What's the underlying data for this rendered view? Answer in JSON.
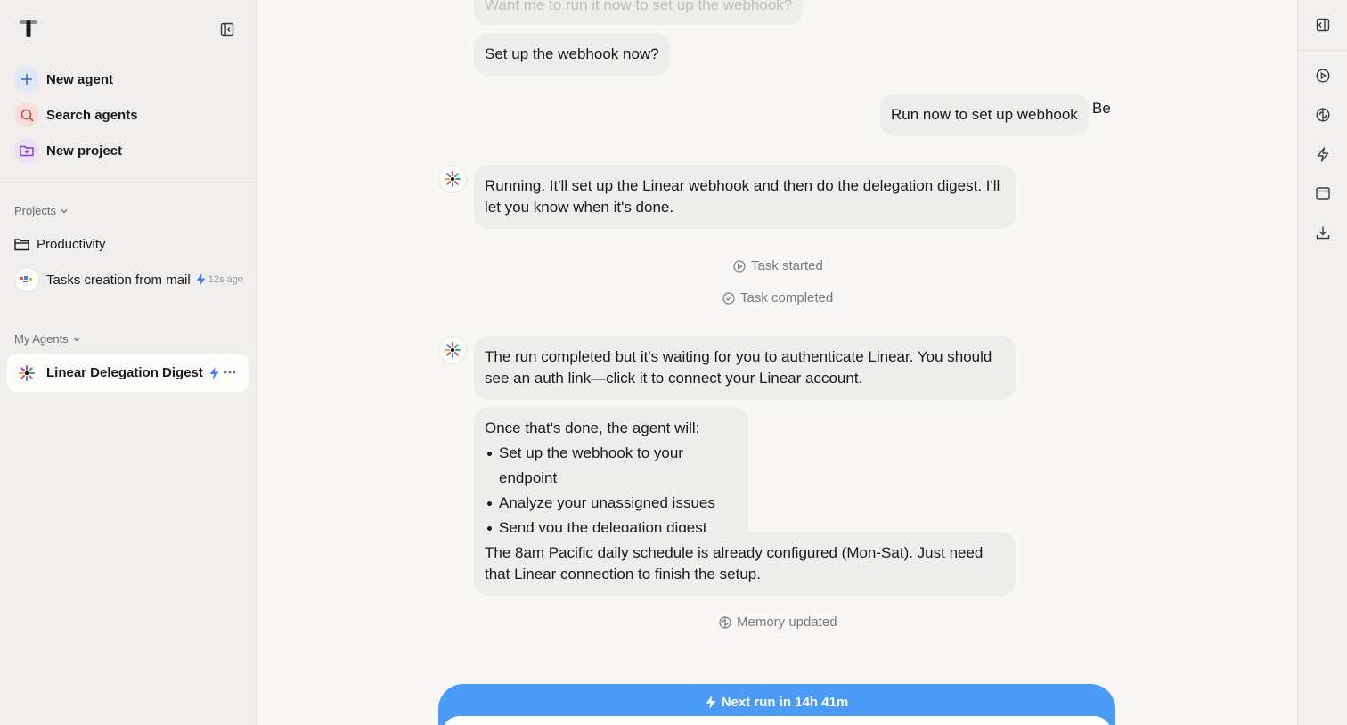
{
  "sidebar": {
    "nav": [
      {
        "label": "New agent",
        "icon": "plus-icon",
        "color": "#3b6fd8",
        "bg": "#dfe8f7"
      },
      {
        "label": "Search agents",
        "icon": "search-icon",
        "color": "#d2453d",
        "bg": "#f6dedb"
      },
      {
        "label": "New project",
        "icon": "folder-plus-icon",
        "color": "#8a3fc7",
        "bg": "#ece0f5"
      }
    ],
    "projects_header": "Projects",
    "projects": [
      {
        "label": "Productivity",
        "icon": "folder-icon"
      }
    ],
    "tasks": [
      {
        "label": "Tasks creation from mail",
        "ago": "12s ago"
      }
    ],
    "agents_header": "My Agents",
    "agents": [
      {
        "label": "Linear Delegation Digest"
      }
    ]
  },
  "chat": {
    "faded_text": "Want me to run it now to set up the webhook?",
    "messages": [
      {
        "text": "Set up the webhook now?"
      },
      {
        "text": "Run now to set up webhook"
      },
      {
        "text": "Running. It'll set up the Linear webhook and then do the delegation digest. I'll let you know when it's done."
      },
      {
        "text": "The run completed but it's waiting for you to authenticate Linear. You should see an auth link—click it to connect your Linear account."
      },
      {
        "intro": "Once that's done, the agent will:",
        "items": [
          "Set up the webhook to your endpoint",
          "Analyze your unassigned issues",
          "Send you the delegation digest"
        ]
      },
      {
        "text": "The 8am Pacific daily schedule is already configured (Mon-Sat). Just need that Linear connection to finish the setup."
      }
    ],
    "side_text": "Be",
    "statuses": {
      "task_started": "Task started",
      "task_completed": "Task completed",
      "memory_updated": "Memory updated"
    },
    "next_run": "Next run in 14h 41m"
  },
  "rail": [
    "panel-icon",
    "play-circle-icon",
    "brain-icon",
    "bolt-icon",
    "browser-window-icon",
    "download-icon"
  ],
  "colors": {
    "accent": "#4a9af6",
    "bolt": "#3b82f6"
  }
}
